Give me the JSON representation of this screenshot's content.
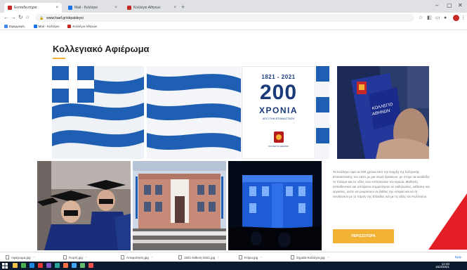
{
  "browser": {
    "tabs": [
      {
        "label": "Εκπαιδευτήρια",
        "favicon_color": "#c62828",
        "active": true
      },
      {
        "label": "Mail - Κολλέγιο",
        "favicon_color": "#1a73e8",
        "active": false
      },
      {
        "label": "Κολλέγιο Αθηνών",
        "favicon_color": "#c62828",
        "active": false
      }
    ],
    "new_tab_icon": "plus-icon",
    "url": "www.haef.gr/ekpaideysi",
    "bookmarks": [
      {
        "label": "Εφαρμογές",
        "icon_color": "#4285f4"
      },
      {
        "label": "Mail - Κολλέγιο",
        "icon_color": "#1a73e8"
      },
      {
        "label": "Κολλέγιο Αθηνών",
        "icon_color": "#c62828"
      }
    ]
  },
  "page": {
    "title": "Κολλεγιακό Αφιέρωμα",
    "accent_color": "#f2b233",
    "anniversary": {
      "years": "1821 - 2021",
      "number": "200",
      "word": "ΧΡΟΝΙΑ",
      "subtitle": "ΑΠΟ ΤΗΝ ΕΠΑΝΑΣΤΑΣΗ",
      "logo_text": "ΚΟΛΛΕΓΙΟ ΑΘΗΝΩΝ"
    },
    "description": "Το Κολλέγιο τιμά τα 200 χρόνια από την έναρξη της Ελληνικής Επανάστασης του 1821 με μια σειρά δράσεων, με στόχο να αναδείξει το πνεύμα και τις αξίες που ενέπνευσαν τον αγώνα. Μαθητές, εκπαιδευτικοί και απόφοιτοι συμμετέχουν σε εκδηλώσεις, εκθέσεις και εργασίες, ώστε να γνωρίσουν σε βάθος την ιστορία και να τη συνδέσουν με το παρόν της Ελλάδας και με τις αξίες του Κολλεγίου.",
    "more_button": "ΠΕΡΙΣΣΟΤΕΡΑ"
  },
  "downloads": {
    "items": [
      "Αφιέρωμα.jpg",
      "Γιορτή.jpg",
      "Αποφοίτηση.jpg",
      "1821-έκθεση-2021.jpg",
      "Κτίριο.jpg",
      "Σημαία-Κολλέγιο.jpg"
    ],
    "show_all": "Εμφ."
  },
  "taskbar": {
    "clock_time": "12:40",
    "clock_date": "15/3/2021",
    "icon_colors": [
      "#f0c14b",
      "#4caf50",
      "#1e88e5",
      "#e53935",
      "#7e57c2",
      "#26a69a",
      "#ff7043",
      "#42a5f5",
      "#66bb6a",
      "#ef5350"
    ]
  }
}
